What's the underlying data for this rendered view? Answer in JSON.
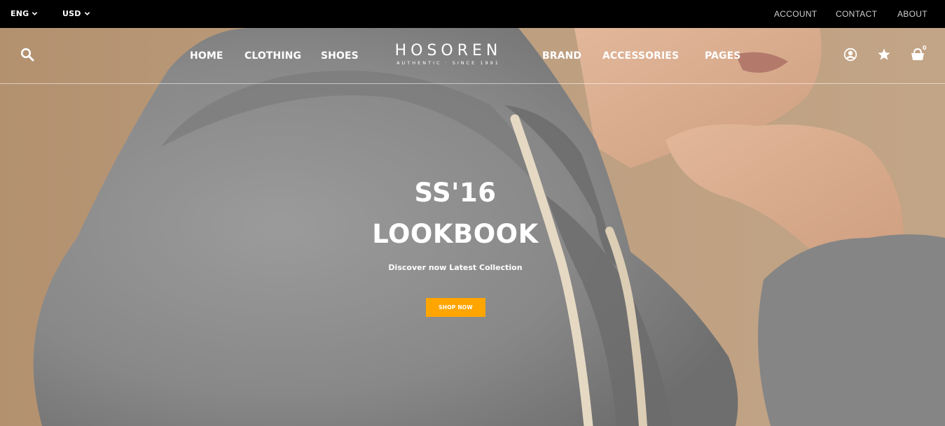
{
  "topbar": {
    "language": "ENG",
    "currency": "USD",
    "links": {
      "account": "ACCOUNT",
      "contact": "CONTACT",
      "about": "ABOUT"
    }
  },
  "nav": {
    "left": {
      "home": "HOME",
      "clothing": "CLOTHING",
      "shoes": "SHOES"
    },
    "right": {
      "brand": "BRAND",
      "accessories": "ACCESSORIES",
      "pages": "PAGES"
    },
    "logo": {
      "name": "HOSOREN",
      "tagline": "AUTHENTIC · SINCE 1991"
    },
    "cart_count": "0",
    "icons": [
      "search-icon",
      "user-icon",
      "star-icon",
      "shopping-basket-icon"
    ]
  },
  "hero": {
    "line1": "SS'16",
    "line2": "LOOKBOOK",
    "subtitle": "Discover now Latest Collection",
    "cta": "SHOP NOW"
  },
  "colors": {
    "topbar_bg": "#000000",
    "accent": "#ffa500",
    "hero_bg": "#b99a7a",
    "hoodie": "#8a8a8a",
    "text": "#ffffff"
  }
}
